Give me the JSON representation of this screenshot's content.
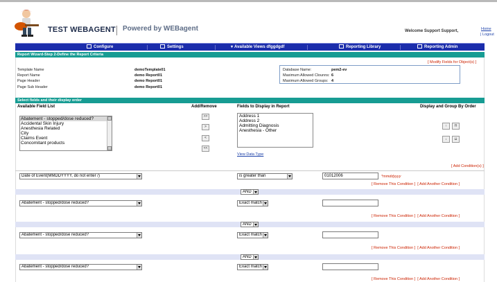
{
  "header": {
    "app_title": "TEST WEBAGENT",
    "powered_by": "Powered by WEBagent",
    "welcome": "Welcome Support Support,",
    "home_link": "Home",
    "logout_link": "| Logout"
  },
  "nav": {
    "items": [
      "Configure",
      "Settings",
      "Available Views dfggdgdf",
      "Reporting Library",
      "Reporting Admin"
    ]
  },
  "step": {
    "title": "Report Wizard-Step 2-Define the Report Criteria",
    "modify_link": "[ Modify Fields for Object(s) ]"
  },
  "report_info": {
    "template_name_label": "Template Name",
    "template_name_value": "demoTemplate01",
    "report_name_label": "Report Name",
    "report_name_value": "demo Report01",
    "page_header_label": "Page Header",
    "page_header_value": "demo Report01",
    "page_sub_header_label": "Page Sub Header",
    "page_sub_header_value": "demo Report01"
  },
  "db_info": {
    "database_label": "Database Name:",
    "database_value": "pem2-ev",
    "max_columns_label": "Maximum Allowed Clounns:",
    "max_columns_value": "6",
    "max_groups_label": "Maximum Allowed Groups:",
    "max_groups_value": "4"
  },
  "fields": {
    "section_title": "Select fields and their display order",
    "available_label": "Available Field List",
    "add_remove_label": "Add/Remove",
    "display_label": "Fields to Display in Report",
    "order_label": "Display and Group By Order",
    "available_items": [
      "Abatement - stopped/dose reduced?",
      "Accidental Skin Injury",
      "Anesthesia Related",
      "City",
      "Claims Event",
      "Concomitant products"
    ],
    "display_items": [
      "Address 1",
      "Address 2",
      "Admitting Diagnosis",
      "Anesthesia - Other"
    ],
    "add_remove_buttons": [
      ">>",
      ">",
      "<",
      "<<"
    ],
    "view_data_type": "View Data Type"
  },
  "conditions": {
    "add_condition_link": "[ Add Condition(s) ]",
    "date_hint": "*mmddyyyy",
    "remove_link": "[ Remove This Condition ]",
    "add_another_link": "[ Add Another Condition ]",
    "and_label": "AND",
    "rows": [
      {
        "field": "Date of Event(MMDDYYYY, do not enter /)",
        "operator": "is greater than",
        "value": "01012006"
      },
      {
        "field": "Abatement - stopped/dose reduced?",
        "operator": "Exact match",
        "value": ""
      },
      {
        "field": "Abatement - stopped/dose reduced?",
        "operator": "Exact match",
        "value": ""
      },
      {
        "field": "Abatement - stopped/dose reduced?",
        "operator": "Exact match",
        "value": ""
      }
    ]
  },
  "colors": {
    "nav_bar": "#1b2dab",
    "section_bar": "#179c93",
    "link": "#1a3fa8",
    "red_link": "#cc2200",
    "and_band": "#dfe3f5"
  }
}
